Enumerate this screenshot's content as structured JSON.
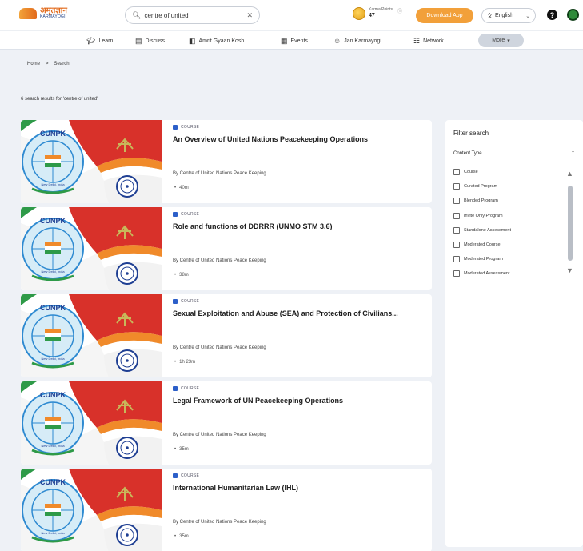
{
  "header": {
    "logo_line1": "अमृतज्ञान",
    "logo_line2": "KARMAYOGI",
    "search_value": "centre of united",
    "karma_label": "Karma Points",
    "karma_value": "47",
    "download_label": "Download App",
    "language": "English"
  },
  "nav": {
    "items": [
      {
        "label": "Learn",
        "icon": "graduation-cap-icon"
      },
      {
        "label": "Discuss",
        "icon": "chat-icon"
      },
      {
        "label": "Amrit Gyaan Kosh",
        "icon": "book-icon"
      },
      {
        "label": "Events",
        "icon": "calendar-icon"
      },
      {
        "label": "Jan Karmayogi",
        "icon": "people-icon"
      },
      {
        "label": "Network",
        "icon": "network-icon"
      }
    ],
    "more_label": "More"
  },
  "breadcrumb": {
    "home": "Home",
    "separator": ">",
    "current": "Search"
  },
  "results_count": "6 search results for 'centre of united'",
  "cards": [
    {
      "type": "COURSE",
      "title": "An Overview of United Nations Peacekeeping Operations",
      "author": "By Centre of United Nations Peace Keeping",
      "duration": "40m"
    },
    {
      "type": "COURSE",
      "title": "Role and functions of DDRRR (UNMO STM 3.6)",
      "author": "By Centre of United Nations Peace Keeping",
      "duration": "38m"
    },
    {
      "type": "COURSE",
      "title": "Sexual Exploitation and Abuse (SEA) and Protection of Civilians...",
      "author": "By Centre of United Nations Peace Keeping",
      "duration": "1h 23m"
    },
    {
      "type": "COURSE",
      "title": "Legal Framework of UN Peacekeeping Operations",
      "author": "By Centre of United Nations Peace Keeping",
      "duration": "35m"
    },
    {
      "type": "COURSE",
      "title": "International Humanitarian Law (IHL)",
      "author": "By Centre of United Nations Peace Keeping",
      "duration": "35m"
    }
  ],
  "thumb_text": {
    "acronym": "CUNPK",
    "location": "New Delhi, India"
  },
  "filter": {
    "title": "Filter search",
    "section": "Content Type",
    "options": [
      "Course",
      "Curated Program",
      "Blended Program",
      "Invite Only Program",
      "Standalone Assessment",
      "Moderated Course",
      "Moderated Program",
      "Moderated Assessment"
    ]
  },
  "colors": {
    "accent": "#f2a03a",
    "background": "#eef1f6",
    "course_badge": "#2c5fc9"
  }
}
